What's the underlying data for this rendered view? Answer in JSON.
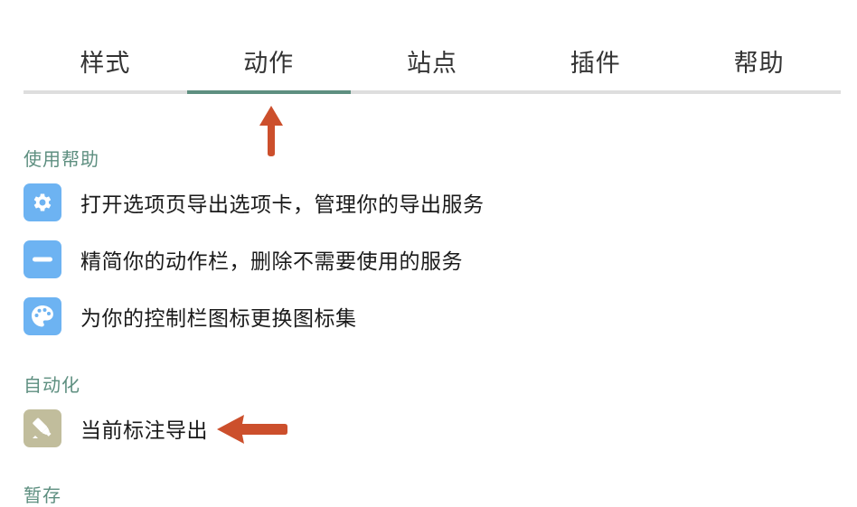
{
  "tabs": [
    {
      "label": "样式"
    },
    {
      "label": "动作"
    },
    {
      "label": "站点"
    },
    {
      "label": "插件"
    },
    {
      "label": "帮助"
    }
  ],
  "active_tab_index": 1,
  "sections": {
    "help": {
      "title": "使用帮助",
      "items": [
        {
          "label": "打开选项页导出选项卡，管理你的导出服务",
          "icon": "gear-icon"
        },
        {
          "label": "精简你的动作栏，删除不需要使用的服务",
          "icon": "minus-icon"
        },
        {
          "label": "为你的控制栏图标更换图标集",
          "icon": "palette-icon"
        }
      ]
    },
    "automation": {
      "title": "自动化",
      "items": [
        {
          "label": "当前标注导出",
          "icon": "highlighter-icon"
        }
      ]
    },
    "next": {
      "title": "暂存"
    }
  },
  "colors": {
    "accent": "#5e8f80",
    "tab_track": "#dedede",
    "blue_icon_bg": "#6db3f2",
    "olive_icon_bg": "#c1bd9c",
    "annotation_arrow": "#cc4f2c"
  }
}
